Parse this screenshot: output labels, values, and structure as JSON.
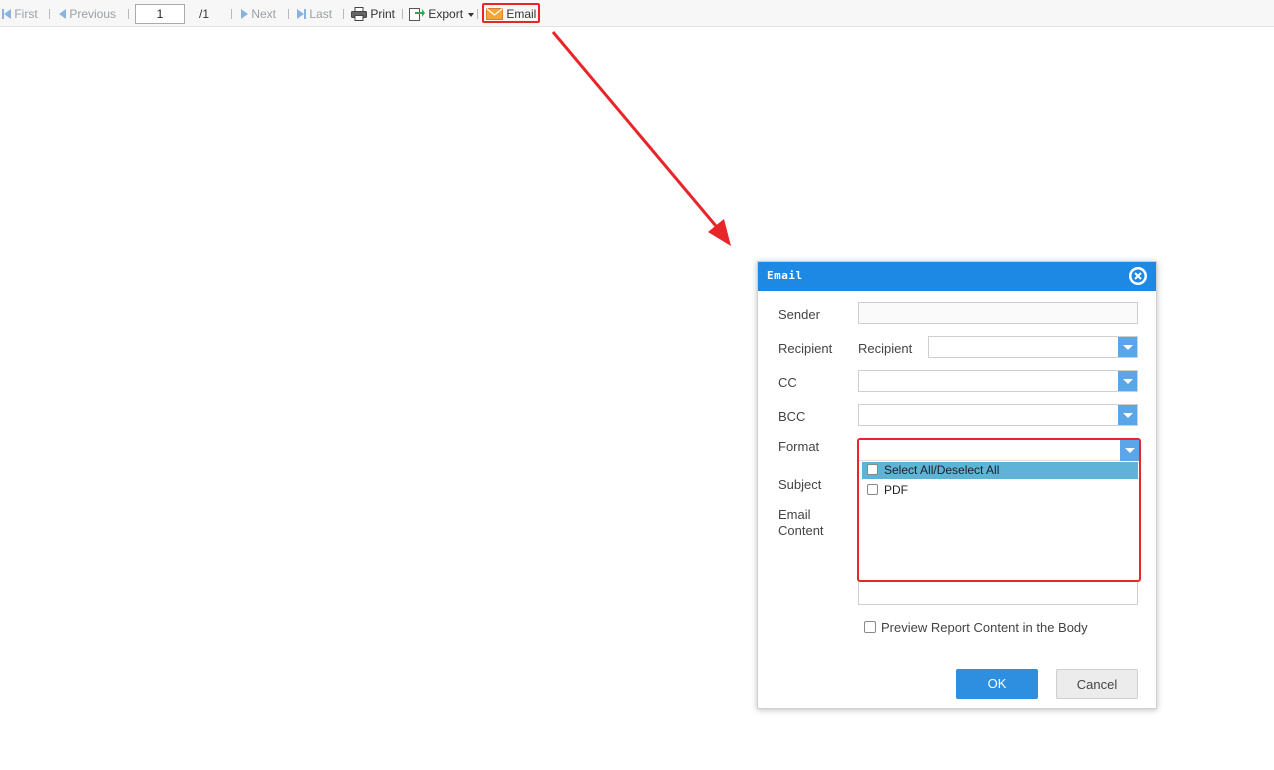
{
  "toolbar": {
    "first": "First",
    "previous": "Previous",
    "page_value": "1",
    "page_total": "/1",
    "next": "Next",
    "last": "Last",
    "print": "Print",
    "export": "Export",
    "email": "Email"
  },
  "dialog": {
    "title": "Email",
    "labels": {
      "sender": "Sender",
      "recipient": "Recipient",
      "recipient_inline": "Recipient",
      "cc": "CC",
      "bcc": "BCC",
      "format": "Format",
      "subject": "Subject",
      "email_content_line1": "Email",
      "email_content_line2": "Content"
    },
    "format_options": [
      {
        "label": "Select All/Deselect All",
        "checked": false,
        "highlighted": true
      },
      {
        "label": "PDF",
        "checked": false,
        "highlighted": false
      }
    ],
    "preview_label": "Preview Report Content in the Body",
    "ok": "OK",
    "cancel": "Cancel"
  },
  "colors": {
    "accent": "#1e88e5",
    "highlight_box": "#e8262a",
    "option_highlight": "#5eb3d6",
    "arrow": "#e8262a"
  }
}
